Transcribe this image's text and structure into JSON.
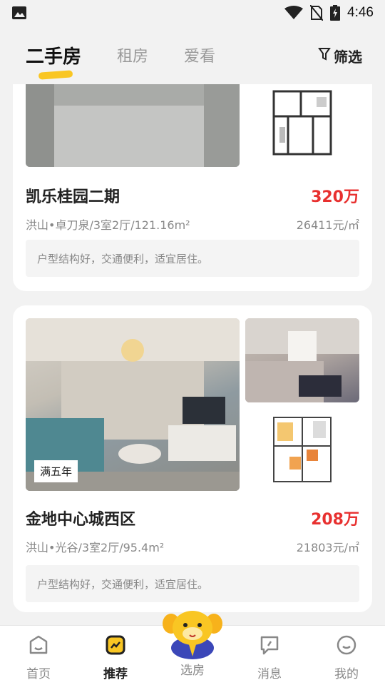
{
  "status_bar": {
    "time": "4:46",
    "icons": [
      "image-icon",
      "wifi-icon",
      "no-sim-icon",
      "battery-charging-icon"
    ]
  },
  "header": {
    "tabs": [
      {
        "label": "二手房",
        "active": true
      },
      {
        "label": "租房",
        "active": false
      },
      {
        "label": "爱看",
        "active": false
      }
    ],
    "filter_label": "筛选",
    "accent_color": "#f9c623"
  },
  "listings": [
    {
      "title": "凯乐桂园二期",
      "price": "320万",
      "meta": "洪山•卓刀泉/3室2厅/121.16m²",
      "unit_price": "26411元/㎡",
      "description": "户型结构好，交通便利，适宜居住。"
    },
    {
      "title": "金地中心城西区",
      "price": "208万",
      "meta": "洪山•光谷/3室2厅/95.4m²",
      "unit_price": "21803元/㎡",
      "description": "户型结构好，交通便利，适宜居住。",
      "badge": "满五年"
    }
  ],
  "price_color": "#e8302f",
  "bottom_nav": [
    {
      "label": "首页",
      "icon": "home-icon",
      "active": false
    },
    {
      "label": "推荐",
      "icon": "recommend-icon",
      "active": true
    },
    {
      "label": "选房",
      "icon": "mascot-icon",
      "active": false
    },
    {
      "label": "消息",
      "icon": "message-icon",
      "active": false
    },
    {
      "label": "我的",
      "icon": "profile-icon",
      "active": false
    }
  ]
}
